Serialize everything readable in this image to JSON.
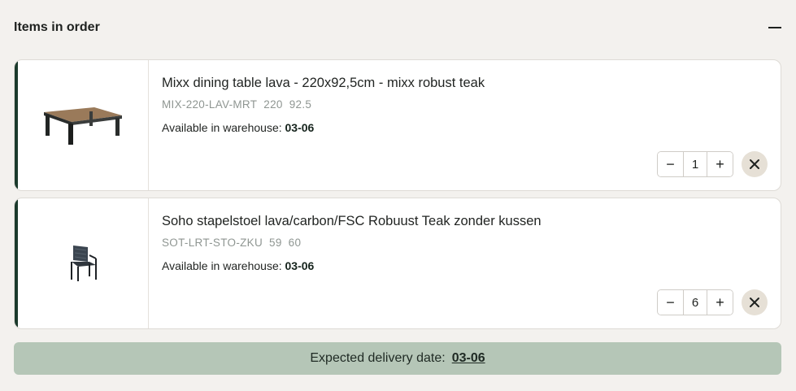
{
  "section": {
    "title": "Items in order"
  },
  "items": [
    {
      "name": "Mixx dining table lava - 220x92,5cm - mixx robust teak",
      "sku": "MIX-220-LAV-MRT",
      "dim1": "220",
      "dim2": "92.5",
      "availability_label": "Available in warehouse:",
      "availability_date": "03-06",
      "quantity": "1",
      "image_icon": "dining-table"
    },
    {
      "name": "Soho stapelstoel lava/carbon/FSC Robuust Teak zonder kussen",
      "sku": "SOT-LRT-STO-ZKU",
      "dim1": "59",
      "dim2": "60",
      "availability_label": "Available in warehouse:",
      "availability_date": "03-06",
      "quantity": "6",
      "image_icon": "stacking-chair"
    }
  ],
  "stepper": {
    "decrement": "−",
    "increment": "+"
  },
  "delivery": {
    "label": "Expected delivery date:",
    "date": "03-06"
  },
  "colors": {
    "accent": "#1b3a2c",
    "delivery_bg": "#b5c6b7",
    "remove_bg": "#e6e0d6"
  }
}
